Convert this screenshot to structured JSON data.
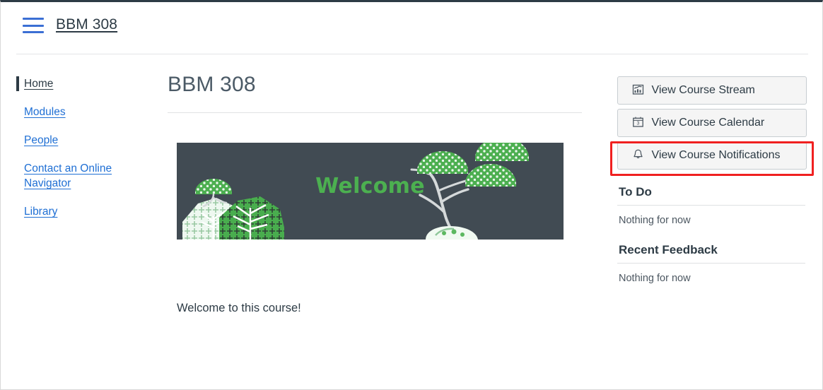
{
  "header": {
    "menu_icon": "hamburger-menu-icon",
    "breadcrumb": "BBM 308"
  },
  "sidebar": {
    "items": [
      {
        "label": "Home",
        "active": true
      },
      {
        "label": "Modules",
        "active": false
      },
      {
        "label": "People",
        "active": false
      },
      {
        "label": "Contact an Online Navigator",
        "active": false
      },
      {
        "label": "Library",
        "active": false
      }
    ]
  },
  "main": {
    "title": "BBM 308",
    "banner": {
      "welcome_text": "Welcome",
      "background_color": "#414b53",
      "text_color": "#4cb050",
      "foliage_color": "#4caf50",
      "foliage_light_color": "#e8f4ea",
      "branch_color": "#d5d9da"
    },
    "body_text": "Welcome to this course!"
  },
  "right_sidebar": {
    "buttons": [
      {
        "label": "View Course Stream",
        "icon": "chart-bars-icon"
      },
      {
        "label": "View Course Calendar",
        "icon": "calendar-icon",
        "calendar_day": "3"
      },
      {
        "label": "View Course Notifications",
        "icon": "bell-icon",
        "highlighted": true
      }
    ],
    "highlight_color": "#f02020",
    "todo": {
      "heading": "To Do",
      "empty_text": "Nothing for now"
    },
    "recent_feedback": {
      "heading": "Recent Feedback",
      "empty_text": "Nothing for now"
    }
  }
}
